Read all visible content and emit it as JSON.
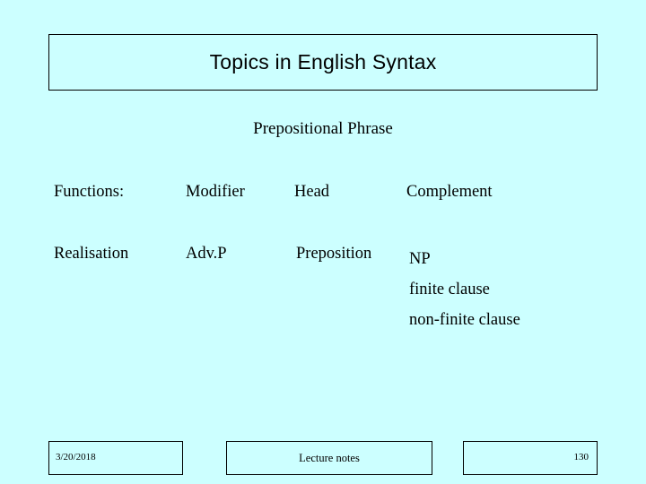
{
  "slide": {
    "background_color": "#ccffff",
    "text_color": "#000000",
    "border_color": "#000000",
    "title": "Topics in English Syntax",
    "subtitle": "Prepositional Phrase"
  },
  "table": {
    "rows": [
      {
        "label": "Functions:",
        "modifier": "Modifier",
        "head": "Head",
        "complement": "Complement"
      },
      {
        "label": "Realisation",
        "modifier": "Adv.P",
        "head": "Preposition",
        "complement": "NP"
      }
    ],
    "complement_alternatives": [
      "NP",
      "finite clause",
      "non-finite clause"
    ]
  },
  "footer": {
    "date": "3/20/2018",
    "center": "Lecture notes",
    "page_number": "130"
  }
}
